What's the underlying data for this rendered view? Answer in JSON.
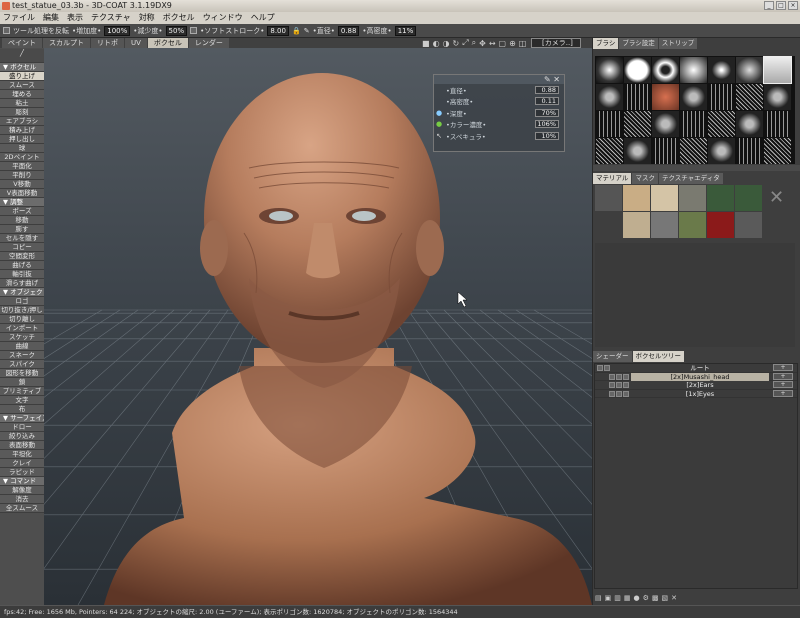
{
  "window": {
    "title": "test_statue_03.3b - 3D-COAT 3.1.19DX9",
    "buttons": [
      "_",
      "□",
      "×"
    ]
  },
  "menu": [
    "ファイル",
    "編集",
    "表示",
    "テクスチャ",
    "対称",
    "ボクセル",
    "ウィンドウ",
    "ヘルプ"
  ],
  "toolbar": {
    "invert_label": "ツール処理を反転",
    "add_label": "•増加度•",
    "add_value": "100%",
    "reduce_label": "•減少度•",
    "reduce_value": "50%",
    "smooth_label": "•ソフトストローク•",
    "smooth_value": "8.00",
    "radius_label": "•直径•",
    "radius_value": "0.88",
    "depth_label": "•高密度•",
    "depth_value": "11%"
  },
  "tabs": [
    {
      "label": "ペイント"
    },
    {
      "label": "スカルプト"
    },
    {
      "label": "リトポ"
    },
    {
      "label": "UV"
    },
    {
      "label": "ボクセル",
      "active": true
    },
    {
      "label": "レンダー"
    }
  ],
  "view_icons": [
    "■",
    "◐",
    "◑",
    "↻",
    "⤢",
    "⌕",
    "✥",
    "↔",
    "▢",
    "⊕",
    "◫"
  ],
  "camera_label": "[カメラ..]",
  "left_panel": [
    {
      "t": "hdr",
      "label": "▼ ボクセル"
    },
    {
      "label": "盛り上げ",
      "sel": true
    },
    {
      "label": "スムース"
    },
    {
      "label": "埋める"
    },
    {
      "label": "粘土"
    },
    {
      "label": "彫刻"
    },
    {
      "label": "エアブラシ"
    },
    {
      "label": "積み上げ"
    },
    {
      "label": "押し出し"
    },
    {
      "label": "球"
    },
    {
      "label": "2Dペイント"
    },
    {
      "label": "平面化"
    },
    {
      "label": "平削り"
    },
    {
      "label": "V移動"
    },
    {
      "label": "V表面移動"
    },
    {
      "t": "hdr",
      "label": "▼ 調整"
    },
    {
      "label": "ポーズ"
    },
    {
      "label": "移動"
    },
    {
      "label": "膨す"
    },
    {
      "label": "セルを隠す"
    },
    {
      "label": "コピー"
    },
    {
      "label": "空間変形"
    },
    {
      "label": "曲げる"
    },
    {
      "label": "軸引抜"
    },
    {
      "label": "滑らす曲げ"
    },
    {
      "t": "hdr",
      "label": "▼ オブジェクト"
    },
    {
      "label": "ロゴ"
    },
    {
      "label": "切り抜き/押し"
    },
    {
      "label": "切り離し"
    },
    {
      "label": "インポート"
    },
    {
      "label": "スケッチ"
    },
    {
      "label": "曲線"
    },
    {
      "label": "スネーク"
    },
    {
      "label": "スパイク"
    },
    {
      "label": "図形を移動"
    },
    {
      "label": "鎖"
    },
    {
      "label": "プリミティブ"
    },
    {
      "label": "文字"
    },
    {
      "label": "布"
    },
    {
      "t": "hdr",
      "label": "▼ サーフェイス"
    },
    {
      "label": "ドロー"
    },
    {
      "label": "絞り込み"
    },
    {
      "label": "表面移動"
    },
    {
      "label": "平坦化"
    },
    {
      "label": "クレイ"
    },
    {
      "label": "ラピッド"
    },
    {
      "t": "hdr",
      "label": "▼ コマンド"
    },
    {
      "label": "解像度"
    },
    {
      "label": "消去"
    },
    {
      "label": "全スムース"
    }
  ],
  "float_panel": {
    "rows": [
      {
        "icon": "",
        "label": "•直径•",
        "value": "0.88"
      },
      {
        "icon": "",
        "label": "•高密度•",
        "value": "0.11"
      },
      {
        "icon": "●",
        "label": "•深度•",
        "value": "70%"
      },
      {
        "icon": "●",
        "label": "•カラー濃度•",
        "value": "106%"
      },
      {
        "icon": "↖",
        "label": "•スペキュラ•",
        "value": "10%"
      }
    ]
  },
  "brush_panel": {
    "tabs": [
      "ブラシ",
      "ブラシ設定",
      "ストリップ"
    ]
  },
  "material_panel": {
    "tabs": [
      "マテリアル",
      "マスク",
      "テクスチャエディタ"
    ]
  },
  "tree_panel": {
    "tabs": [
      "シェーダー",
      "ボクセルツリー"
    ],
    "root": "ルート",
    "items": [
      {
        "label": "[2x]Musashi_head",
        "sel": true
      },
      {
        "label": "[2x]Ears"
      },
      {
        "label": "[1x]Eyes"
      }
    ],
    "plus": "+"
  },
  "status": "fps:42;     Free: 1656 Mb,  Pointers: 64 224;  オブジェクトの縮尺: 2.00 (ユーファーム); 表示ポリゴン数: 1620784; オブジェクトのポリゴン数: 1564344"
}
